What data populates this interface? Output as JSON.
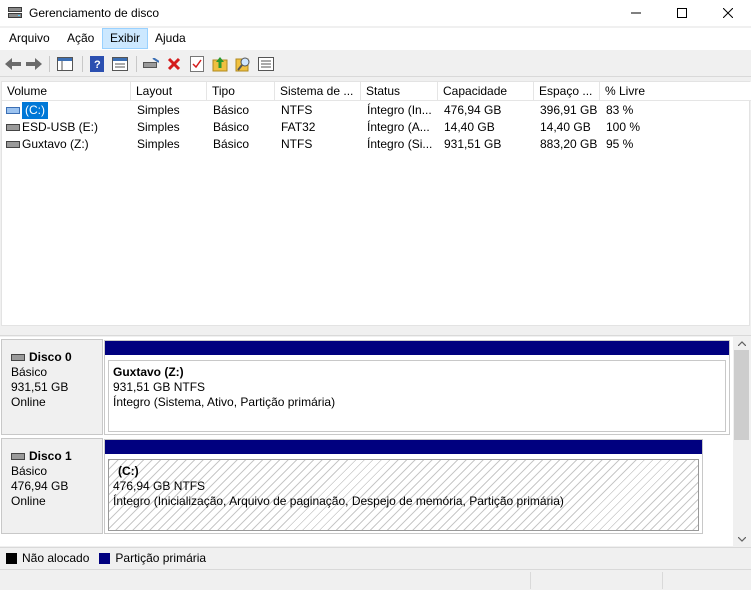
{
  "window": {
    "title": "Gerenciamento de disco"
  },
  "menu": [
    {
      "label": "Arquivo",
      "active": false
    },
    {
      "label": "Ação",
      "active": false
    },
    {
      "label": "Exibir",
      "active": true
    },
    {
      "label": "Ajuda",
      "active": false
    }
  ],
  "toolbar": {
    "icons": [
      "back-icon",
      "forward-icon",
      "console-tree-icon",
      "help-icon",
      "view-icon",
      "connect-icon",
      "delete-icon",
      "check-icon",
      "refresh-icon",
      "search-icon",
      "properties-icon"
    ]
  },
  "volume_list": {
    "columns": [
      "Volume",
      "Layout",
      "Tipo",
      "Sistema de ...",
      "Status",
      "Capacidade",
      "Espaço ...",
      "% Livre"
    ],
    "rows": [
      {
        "volume": "(C:)",
        "layout": "Simples",
        "tipo": "Básico",
        "fs": "NTFS",
        "status": "Íntegro (In...",
        "capacidade": "476,94 GB",
        "espaco": "396,91 GB",
        "livre": "83 %",
        "selected": true
      },
      {
        "volume": "ESD-USB (E:)",
        "layout": "Simples",
        "tipo": "Básico",
        "fs": "FAT32",
        "status": "Íntegro (A...",
        "capacidade": "14,40 GB",
        "espaco": "14,40 GB",
        "livre": "100 %",
        "selected": false
      },
      {
        "volume": "Guxtavo (Z:)",
        "layout": "Simples",
        "tipo": "Básico",
        "fs": "NTFS",
        "status": "Íntegro (Si...",
        "capacidade": "931,51 GB",
        "espaco": "883,20 GB",
        "livre": "95 %",
        "selected": false
      }
    ]
  },
  "disks": [
    {
      "name": "Disco 0",
      "type": "Básico",
      "size": "931,51 GB",
      "state": "Online",
      "partition": {
        "name": "Guxtavo  (Z:)",
        "size": "931,51 GB NTFS",
        "status": "Íntegro (Sistema, Ativo, Partição primária)"
      }
    },
    {
      "name": "Disco 1",
      "type": "Básico",
      "size": "476,94 GB",
      "state": "Online",
      "partition": {
        "name": "(C:)",
        "size": "476,94 GB NTFS",
        "status": "Íntegro (Inicialização, Arquivo de paginação, Despejo de memória, Partição primária)"
      }
    }
  ],
  "legend": [
    {
      "label": "Não alocado",
      "color": "#000000"
    },
    {
      "label": "Partição primária",
      "color": "#00007f"
    }
  ],
  "colors": {
    "primary_partition": "#00007f",
    "selection": "#0078d7"
  }
}
